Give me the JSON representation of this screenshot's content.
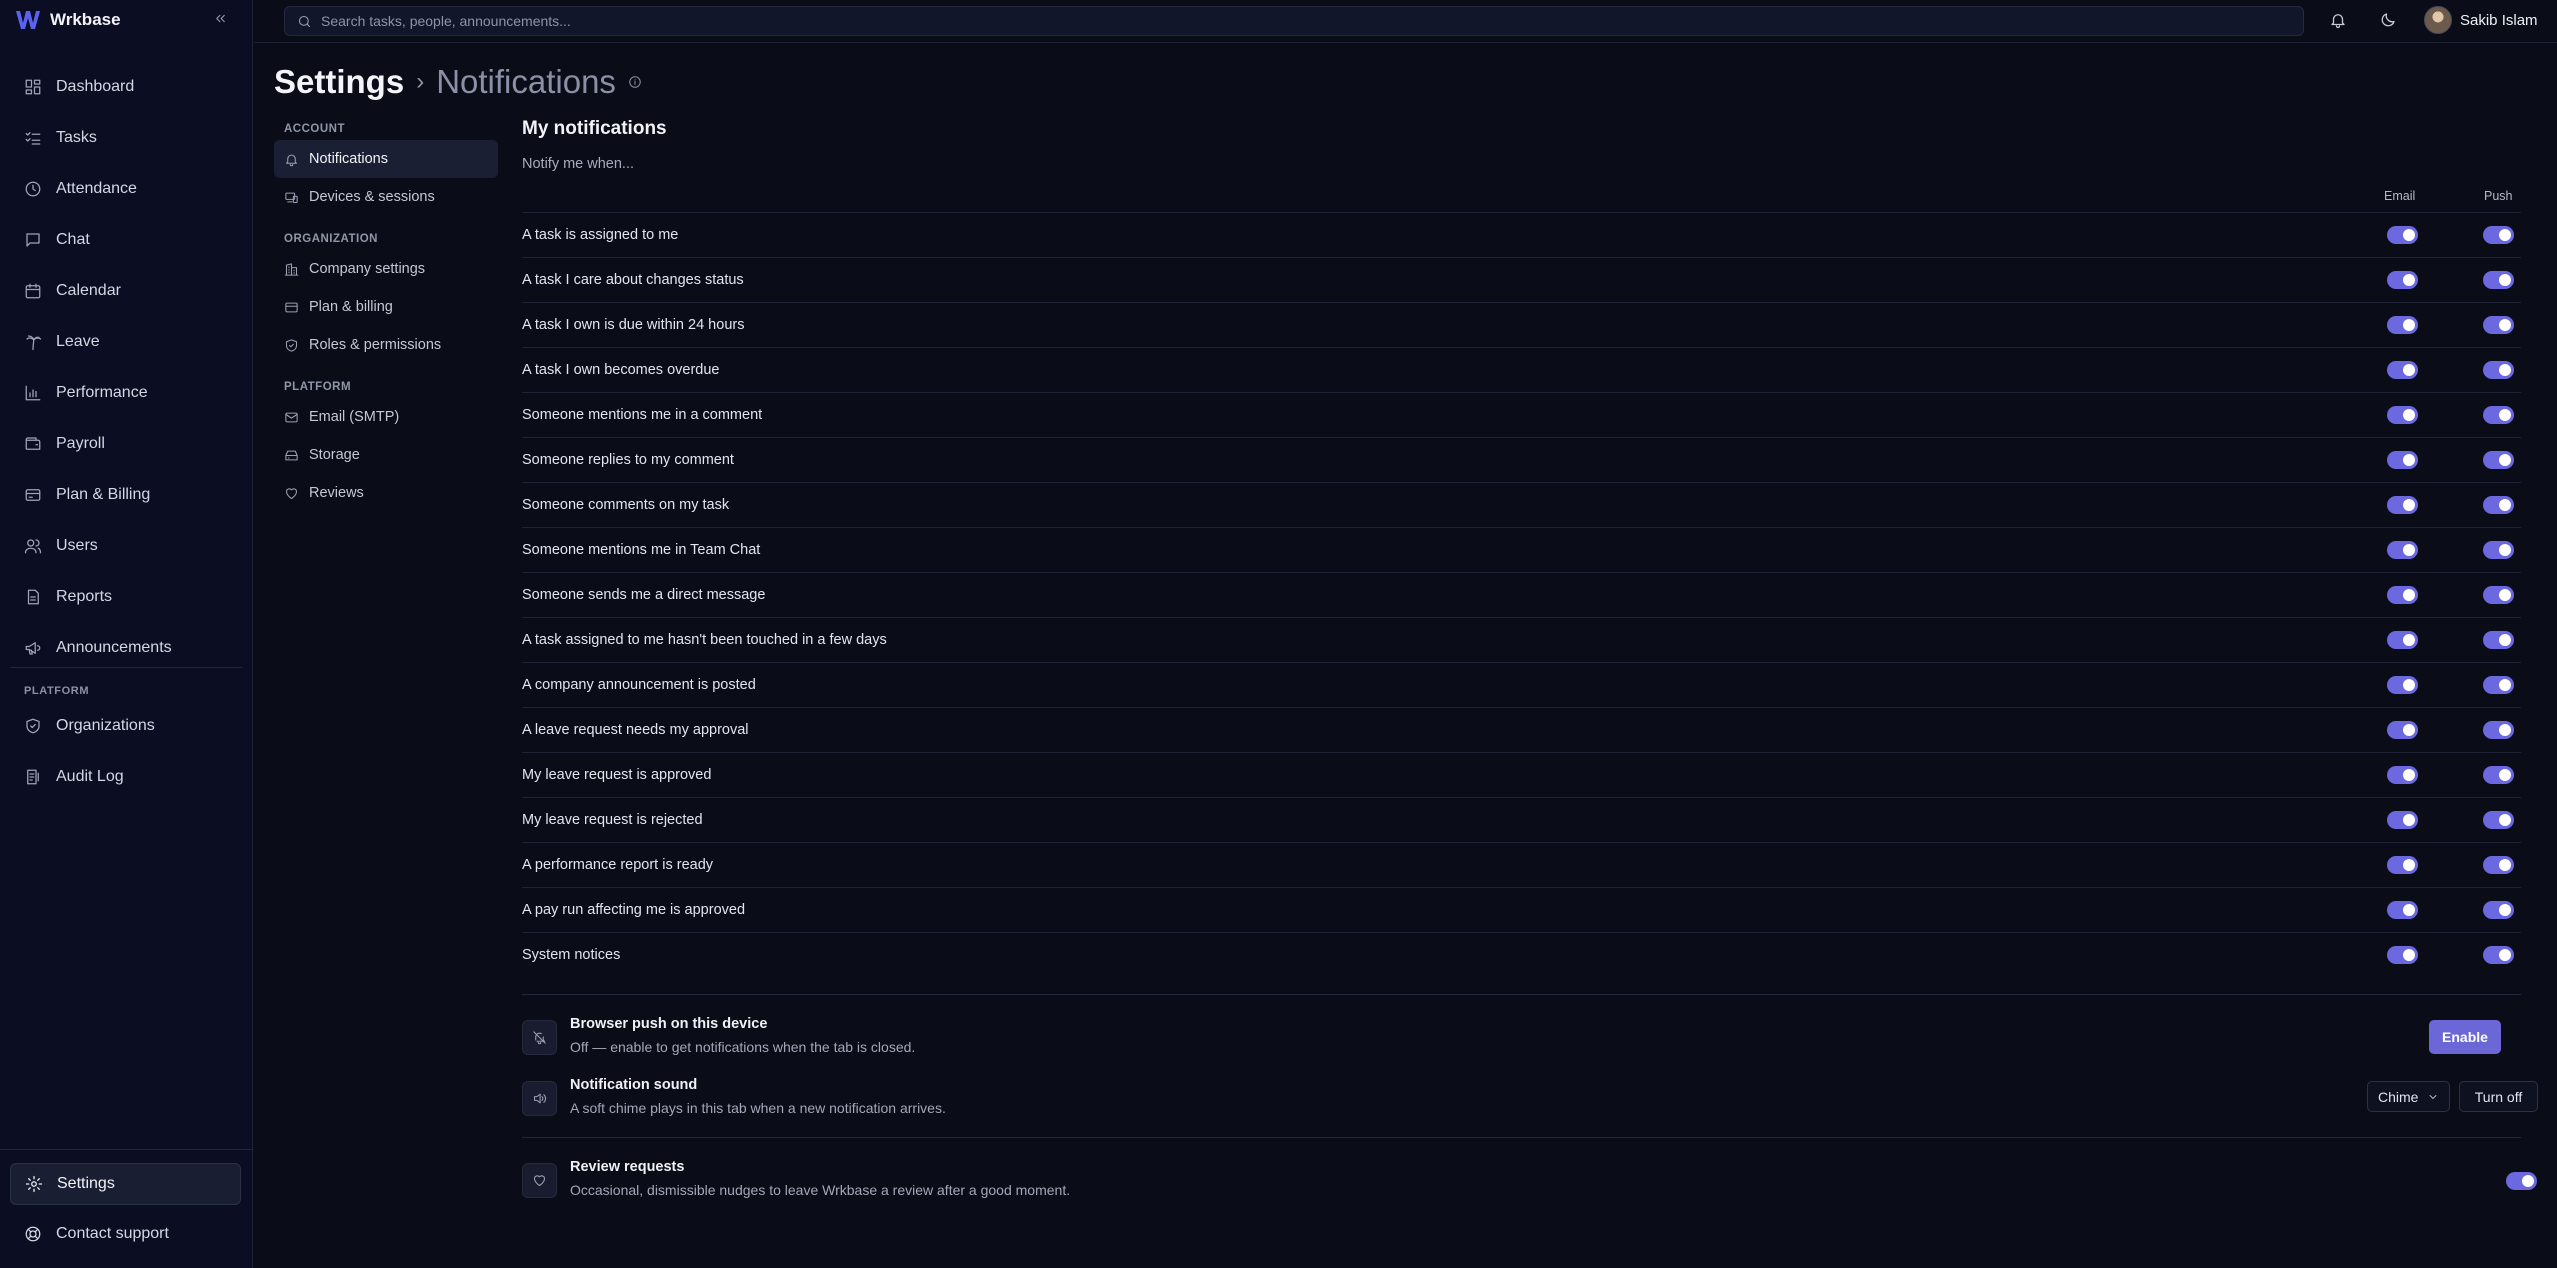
{
  "app": {
    "name": "Wrkbase"
  },
  "sidebar": {
    "items": [
      {
        "label": "Dashboard",
        "icon": "dashboard-icon"
      },
      {
        "label": "Tasks",
        "icon": "tasks-icon"
      },
      {
        "label": "Attendance",
        "icon": "clock-icon"
      },
      {
        "label": "Chat",
        "icon": "chat-icon"
      },
      {
        "label": "Calendar",
        "icon": "calendar-icon"
      },
      {
        "label": "Leave",
        "icon": "palm-tree-icon"
      },
      {
        "label": "Performance",
        "icon": "bar-chart-icon"
      },
      {
        "label": "Payroll",
        "icon": "wallet-icon"
      },
      {
        "label": "Plan & Billing",
        "icon": "credit-card-icon"
      },
      {
        "label": "Users",
        "icon": "users-icon"
      },
      {
        "label": "Reports",
        "icon": "file-icon"
      },
      {
        "label": "Announcements",
        "icon": "megaphone-icon"
      }
    ],
    "platform_section": "PLATFORM",
    "platform_items": [
      {
        "label": "Organizations",
        "icon": "shield-icon"
      },
      {
        "label": "Audit Log",
        "icon": "audit-log-icon"
      }
    ],
    "settings_label": "Settings",
    "support_label": "Contact support"
  },
  "topbar": {
    "search_placeholder": "Search tasks, people, announcements...",
    "user_name": "Sakib Islam"
  },
  "heading": {
    "title": "Settings",
    "subtitle": "Notifications"
  },
  "subnav": {
    "account_section": "ACCOUNT",
    "account_items": [
      "Notifications",
      "Devices & sessions"
    ],
    "organization_section": "ORGANIZATION",
    "organization_items": [
      "Company settings",
      "Plan & billing",
      "Roles & permissions"
    ],
    "platform_section": "PLATFORM",
    "platform_items": [
      "Email (SMTP)",
      "Storage",
      "Reviews"
    ]
  },
  "notifications": {
    "title": "My notifications",
    "subtitle": "Notify me when...",
    "col_email": "Email",
    "col_push": "Push",
    "rows": [
      {
        "label": "A task is assigned to me",
        "email": true,
        "push": true
      },
      {
        "label": "A task I care about changes status",
        "email": true,
        "push": true
      },
      {
        "label": "A task I own is due within 24 hours",
        "email": true,
        "push": true
      },
      {
        "label": "A task I own becomes overdue",
        "email": true,
        "push": true
      },
      {
        "label": "Someone mentions me in a comment",
        "email": true,
        "push": true
      },
      {
        "label": "Someone replies to my comment",
        "email": true,
        "push": true
      },
      {
        "label": "Someone comments on my task",
        "email": true,
        "push": true
      },
      {
        "label": "Someone mentions me in Team Chat",
        "email": true,
        "push": true
      },
      {
        "label": "Someone sends me a direct message",
        "email": true,
        "push": true
      },
      {
        "label": "A task assigned to me hasn't been touched in a few days",
        "email": true,
        "push": true
      },
      {
        "label": "A company announcement is posted",
        "email": true,
        "push": true
      },
      {
        "label": "A leave request needs my approval",
        "email": true,
        "push": true
      },
      {
        "label": "My leave request is approved",
        "email": true,
        "push": true
      },
      {
        "label": "My leave request is rejected",
        "email": true,
        "push": true
      },
      {
        "label": "A performance report is ready",
        "email": true,
        "push": true
      },
      {
        "label": "A pay run affecting me is approved",
        "email": true,
        "push": true
      },
      {
        "label": "System notices",
        "email": true,
        "push": true
      }
    ]
  },
  "browser_push": {
    "title": "Browser push on this device",
    "description": "Off — enable to get notifications when the tab is closed.",
    "button": "Enable"
  },
  "sound": {
    "title": "Notification sound",
    "description": "A soft chime plays in this tab when a new notification arrives.",
    "selected": "Chime",
    "button": "Turn off"
  },
  "review": {
    "title": "Review requests",
    "description": "Occasional, dismissible nudges to leave Wrkbase a review after a good moment.",
    "enabled": true
  },
  "colors": {
    "accent": "#6b68e0",
    "background": "#0a0d17",
    "sidebar": "#0b0d22"
  }
}
